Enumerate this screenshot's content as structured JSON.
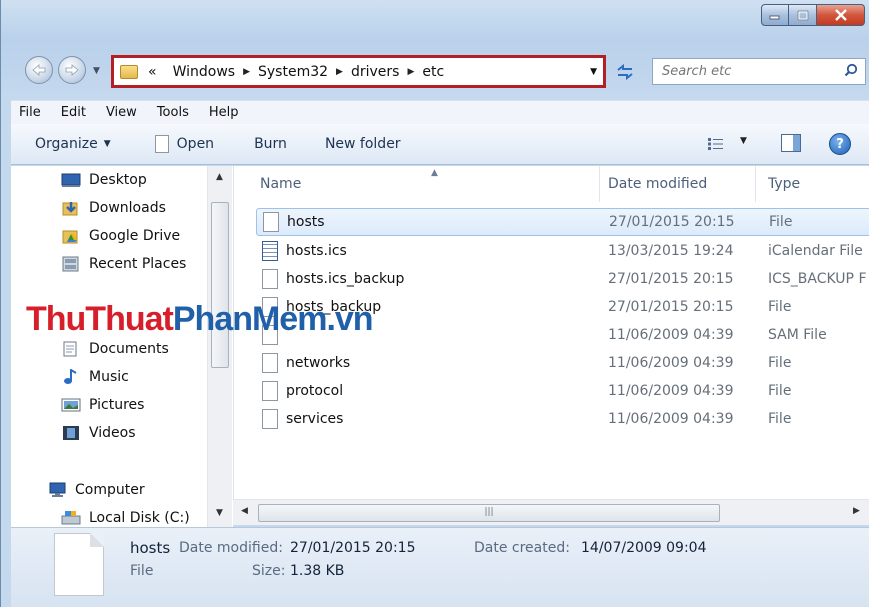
{
  "address_bar": {
    "overflow_glyph": "«",
    "crumbs": [
      "Windows",
      "System32",
      "drivers",
      "etc"
    ]
  },
  "search": {
    "placeholder": "Search etc"
  },
  "menu": [
    "File",
    "Edit",
    "View",
    "Tools",
    "Help"
  ],
  "toolbar": {
    "organize": "Organize",
    "open": "Open",
    "burn": "Burn",
    "new_folder": "New folder"
  },
  "nav_pane": {
    "items": [
      {
        "label": "Desktop",
        "icon": "desktop-icon"
      },
      {
        "label": "Downloads",
        "icon": "downloads-icon"
      },
      {
        "label": "Google Drive",
        "icon": "google-drive-icon"
      },
      {
        "label": "Recent Places",
        "icon": "recent-places-icon"
      },
      {
        "label": "Documents",
        "icon": "documents-icon"
      },
      {
        "label": "Music",
        "icon": "music-icon"
      },
      {
        "label": "Pictures",
        "icon": "pictures-icon"
      },
      {
        "label": "Videos",
        "icon": "videos-icon"
      },
      {
        "label": "Computer",
        "icon": "computer-icon"
      },
      {
        "label": "Local Disk (C:)",
        "icon": "local-disk-icon"
      }
    ]
  },
  "columns": {
    "name": "Name",
    "date": "Date modified",
    "type": "Type"
  },
  "files": [
    {
      "name": "hosts",
      "date": "27/01/2015 20:15",
      "type": "File",
      "selected": true
    },
    {
      "name": "hosts.ics",
      "date": "13/03/2015 19:24",
      "type": "iCalendar File"
    },
    {
      "name": "hosts.ics_backup",
      "date": "27/01/2015 20:15",
      "type": "ICS_BACKUP F"
    },
    {
      "name": "hosts_backup",
      "date": "27/01/2015 20:15",
      "type": "File"
    },
    {
      "name": "",
      "date": "11/06/2009 04:39",
      "type": "SAM File"
    },
    {
      "name": "networks",
      "date": "11/06/2009 04:39",
      "type": "File"
    },
    {
      "name": "protocol",
      "date": "11/06/2009 04:39",
      "type": "File"
    },
    {
      "name": "services",
      "date": "11/06/2009 04:39",
      "type": "File"
    }
  ],
  "details": {
    "name": "hosts",
    "type": "File",
    "date_modified_label": "Date modified:",
    "date_modified": "27/01/2015 20:15",
    "size_label": "Size:",
    "size": "1.38 KB",
    "date_created_label": "Date created:",
    "date_created": "14/07/2009 09:04"
  },
  "watermark": {
    "part1": "ThuThuat",
    "part2": "PhanMem",
    "part3": ".vn"
  },
  "colors": {
    "address_highlight": "#b41f24",
    "watermark_red": "#d71f2b",
    "watermark_blue": "#1f60a8",
    "selection": "#dbeafb"
  }
}
